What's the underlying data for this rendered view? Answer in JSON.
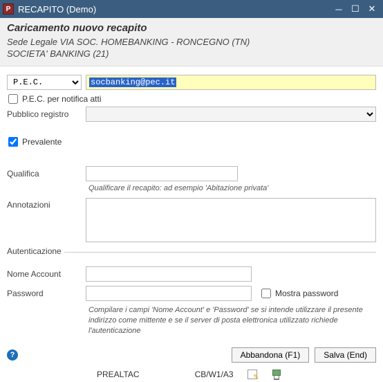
{
  "window": {
    "app_icon_letter": "P",
    "title": "RECAPITO  (Demo)"
  },
  "header": {
    "title": "Caricamento nuovo recapito",
    "line1": "Sede Legale VIA SOC. HOMEBANKING - RONCEGNO (TN)",
    "line2": "SOCIETA' BANKING (21)"
  },
  "form": {
    "type_value": "P.E.C.",
    "pec_value": "socbanking@pec.it",
    "pec_notifica_label": "P.E.C. per notifica atti",
    "pec_notifica_checked": false,
    "pubblico_label": "Pubblico registro",
    "pubblico_value": "",
    "prevalente_label": "Prevalente",
    "prevalente_checked": true,
    "qualifica_label": "Qualifica",
    "qualifica_value": "",
    "qualifica_hint": "Qualificare il recapito: ad esempio 'Abitazione privata'",
    "annotazioni_label": "Annotazioni",
    "annotazioni_value": ""
  },
  "auth": {
    "title": "Autenticazione",
    "nome_label": "Nome Account",
    "nome_value": "",
    "password_label": "Password",
    "password_value": "",
    "mostra_label": "Mostra password",
    "mostra_checked": false,
    "hint": "Compilare i campi 'Nome Account' e 'Password' se si intende utilizzare il presente indirizzo come mittente e se il server di posta elettronica utilizzato richiede l'autenticazione"
  },
  "buttons": {
    "abbandona": "Abbandona (F1)",
    "salva": "Salva (End)"
  },
  "status": {
    "left": "PREALTAC",
    "mid": "CB/W1/A3"
  }
}
